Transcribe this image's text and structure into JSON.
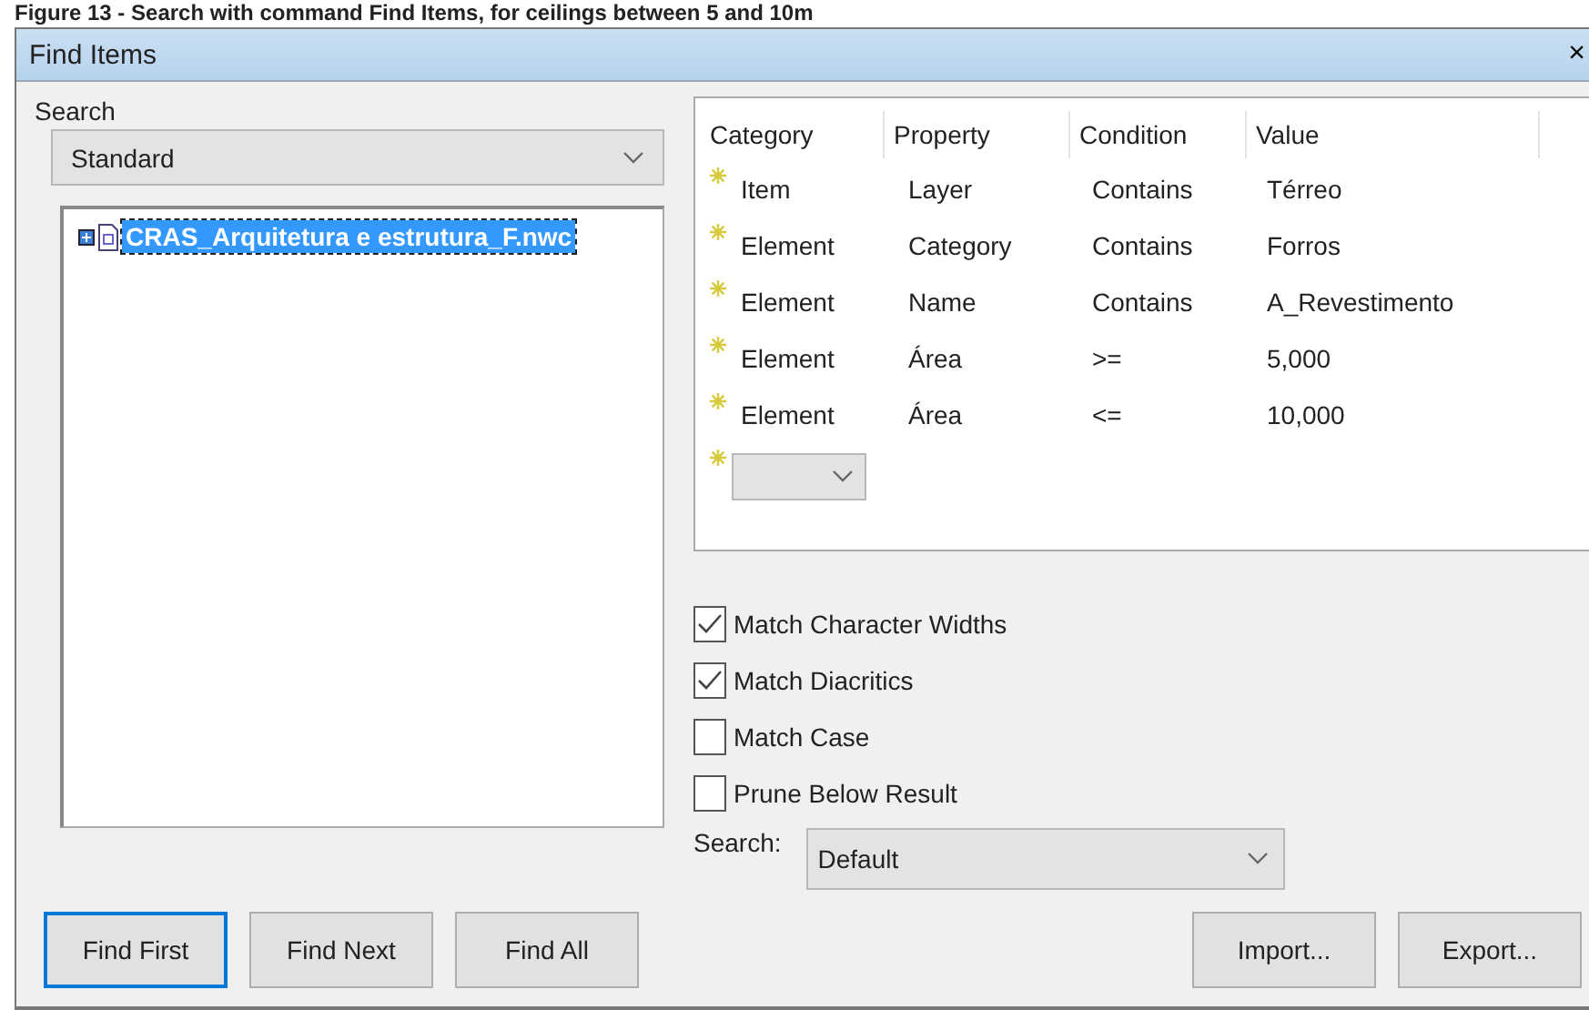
{
  "caption": "Figure 13 - Search with command Find Items, for ceilings between 5 and 10m",
  "window": {
    "title": "Find Items",
    "close": "×"
  },
  "search": {
    "label": "Search",
    "value": "Standard"
  },
  "tree": {
    "items": [
      {
        "label": "CRAS_Arquitetura e estrutura_F.nwc",
        "selected": true,
        "expanded": false
      }
    ]
  },
  "conditions": {
    "columns": [
      "Category",
      "Property",
      "Condition",
      "Value"
    ],
    "rows": [
      {
        "category": "Item",
        "property": "Layer",
        "condition": "Contains",
        "value": "Térreo"
      },
      {
        "category": "Element",
        "property": "Category",
        "condition": "Contains",
        "value": "Forros"
      },
      {
        "category": "Element",
        "property": "Name",
        "condition": "Contains",
        "value": "A_Revestimento"
      },
      {
        "category": "Element",
        "property": "Área",
        "condition": ">=",
        "value": "5,000"
      },
      {
        "category": "Element",
        "property": "Área",
        "condition": "<=",
        "value": "10,000"
      }
    ]
  },
  "options": [
    {
      "label": "Match Character Widths",
      "checked": true
    },
    {
      "label": "Match Diacritics",
      "checked": true
    },
    {
      "label": "Match Case",
      "checked": false
    },
    {
      "label": "Prune Below Result",
      "checked": false
    }
  ],
  "search_mode": {
    "label": "Search:",
    "value": "Default"
  },
  "buttons_left": [
    {
      "label": "Find First",
      "selected": true
    },
    {
      "label": "Find Next",
      "selected": false
    },
    {
      "label": "Find All",
      "selected": false
    }
  ],
  "buttons_right": [
    "Import...",
    "Export..."
  ]
}
